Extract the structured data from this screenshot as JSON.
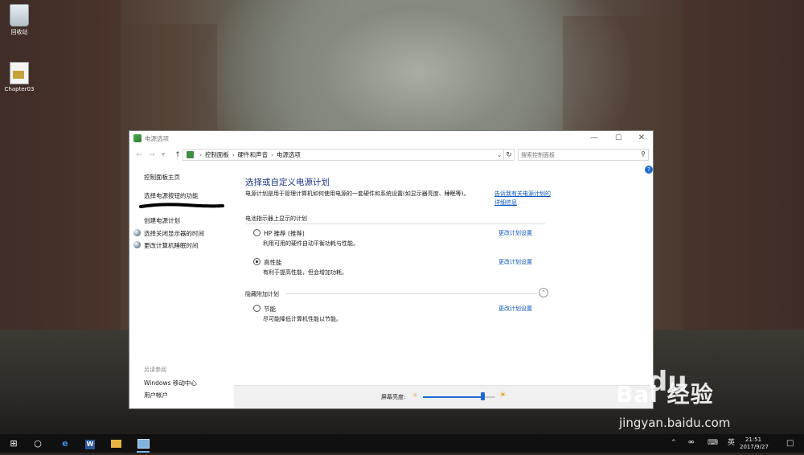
{
  "desktop": {
    "icons": [
      {
        "label": "回收站",
        "icon": "recycle-bin-icon"
      },
      {
        "label": "Chapter03",
        "icon": "document-icon"
      }
    ]
  },
  "window": {
    "title": "电源选项",
    "address": {
      "crumbs": [
        "控制面板",
        "硬件和声音",
        "电源选项"
      ],
      "search_placeholder": "搜索控制面板"
    },
    "sidebar": {
      "home": "控制面板主页",
      "power_buttons": "选择电源按钮的功能",
      "create_plan": "创建电源计划",
      "display_off": "选择关闭显示器的时间",
      "sleep_time": "更改计算机睡眠时间",
      "see_also": "另请参阅",
      "mobility": "Windows 移动中心",
      "accounts": "用户帐户"
    },
    "main": {
      "title": "选择或自定义电源计划",
      "description": "电源计划是用于管理计算机如何使用电源的一套硬件和系统设置(如显示器亮度、睡眠等)。",
      "description_link": "告诉我有关电源计划的详细信息",
      "battery_section": "电池指示器上显示的计划",
      "hidden_section": "隐藏附加计划",
      "change_label": "更改计划设置",
      "plans": [
        {
          "name": "HP 推荐 (推荐)",
          "desc": "利用可用的硬件自动平衡功耗与性能。",
          "selected": false
        },
        {
          "name": "高性能",
          "desc": "有利于提高性能，但会增加功耗。",
          "selected": true
        },
        {
          "name": "节能",
          "desc": "尽可能降低计算机性能以节能。",
          "selected": false
        }
      ]
    },
    "brightness": {
      "label": "屏幕亮度:",
      "level": 0.82
    }
  },
  "watermark": {
    "brand": "Bai  经验",
    "paw": "du",
    "url": "jingyan.baidu.com"
  },
  "taskbar": {
    "ime": "英",
    "time": "21:51",
    "date": "2017/9/27",
    "word_letter": "W"
  }
}
